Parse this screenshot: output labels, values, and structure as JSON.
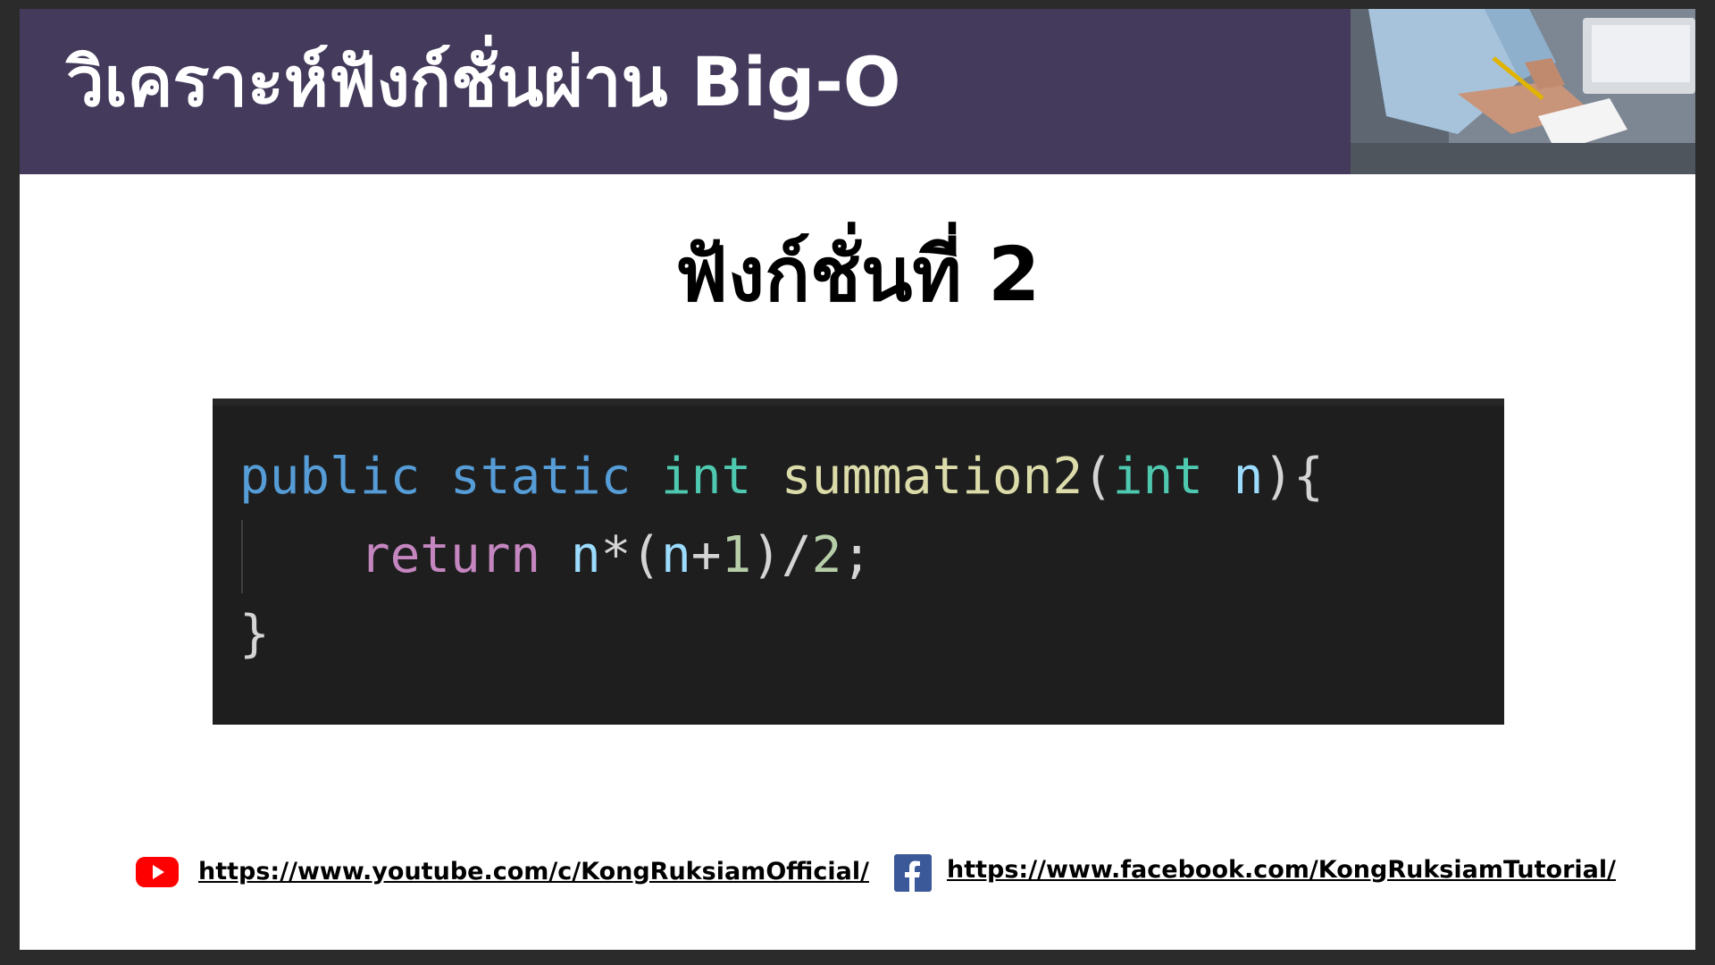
{
  "slide": {
    "title": "วิเคราะห์ฟังก์ชั่นผ่าน Big-O",
    "subtitle": "ฟังก์ชั่นที่ 2"
  },
  "code": {
    "line1": {
      "public": "public",
      "static": "static",
      "int": "int",
      "fn": "summation2",
      "open": "(",
      "int2": "int",
      "param": "n",
      "close": "){"
    },
    "line2": {
      "return": "return",
      "var": "n",
      "op": "*(",
      "var2": "n",
      "plus": "+",
      "one": "1",
      "rest": ")/",
      "two": "2",
      "semi": ";"
    },
    "line3": "}"
  },
  "footer": {
    "youtube_url": "https://www.youtube.com/c/KongRuksiamOfficial/",
    "facebook_url": "https://www.facebook.com/KongRuksiamTutorial/"
  },
  "colors": {
    "title_bar": "#443a5c",
    "code_background": "#1e1e1e",
    "youtube_red": "#ff0000",
    "facebook_blue": "#3b5998"
  },
  "icons": {
    "youtube": "youtube-icon",
    "facebook": "facebook-icon",
    "photo": "person-writing-photo"
  }
}
